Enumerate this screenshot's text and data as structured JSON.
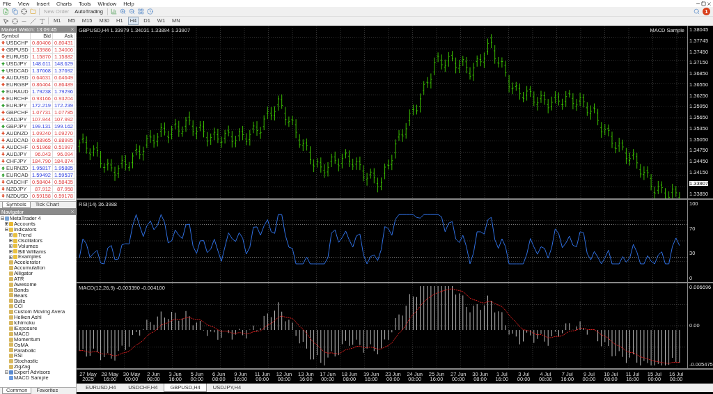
{
  "menu": [
    "File",
    "View",
    "Insert",
    "Charts",
    "Tools",
    "Window",
    "Help"
  ],
  "toolbar": {
    "buttons": [
      {
        "label": "New Order",
        "disabled": true
      },
      {
        "label": "AutoTrading",
        "disabled": false
      }
    ],
    "timeframes": [
      {
        "label": "M1",
        "selected": false
      },
      {
        "label": "M5",
        "selected": false
      },
      {
        "label": "M15",
        "selected": false
      },
      {
        "label": "M30",
        "selected": false
      },
      {
        "label": "H1",
        "selected": false
      },
      {
        "label": "H4",
        "selected": true
      },
      {
        "label": "D1",
        "selected": false
      },
      {
        "label": "W1",
        "selected": false
      },
      {
        "label": "MN",
        "selected": false
      }
    ],
    "notifications": "1"
  },
  "market_watch": {
    "title": "Market Watch: 13:09:45",
    "columns": [
      "Symbol",
      "Bid",
      "Ask"
    ],
    "rows": [
      {
        "symbol": "USDCHF",
        "bid": "0.80406",
        "ask": "0.80431",
        "rising": false
      },
      {
        "symbol": "GBPUSD",
        "bid": "1.33986",
        "ask": "1.34006",
        "rising": false
      },
      {
        "symbol": "EURUSD",
        "bid": "1.15870",
        "ask": "1.15882",
        "rising": false
      },
      {
        "symbol": "USDJPY",
        "bid": "148.611",
        "ask": "148.629",
        "rising": true
      },
      {
        "symbol": "USDCAD",
        "bid": "1.37668",
        "ask": "1.37692",
        "rising": true
      },
      {
        "symbol": "AUDUSD",
        "bid": "0.64631",
        "ask": "0.64649",
        "rising": false
      },
      {
        "symbol": "EURGBP",
        "bid": "0.86464",
        "ask": "0.86489",
        "rising": false
      },
      {
        "symbol": "EURAUD",
        "bid": "1.79238",
        "ask": "1.79296",
        "rising": true
      },
      {
        "symbol": "EURCHF",
        "bid": "0.93166",
        "ask": "0.93204",
        "rising": false
      },
      {
        "symbol": "EURJPY",
        "bid": "172.219",
        "ask": "172.239",
        "rising": true
      },
      {
        "symbol": "GBPCHF",
        "bid": "1.07731",
        "ask": "1.07785",
        "rising": false
      },
      {
        "symbol": "CADJPY",
        "bid": "107.944",
        "ask": "107.992",
        "rising": false
      },
      {
        "symbol": "GBPJPY",
        "bid": "199.131",
        "ask": "199.162",
        "rising": true
      },
      {
        "symbol": "AUDNZD",
        "bid": "1.09240",
        "ask": "1.09270",
        "rising": false
      },
      {
        "symbol": "AUDCAD",
        "bid": "0.88965",
        "ask": "0.88995",
        "rising": false
      },
      {
        "symbol": "AUDCHF",
        "bid": "0.51968",
        "ask": "0.51997",
        "rising": false
      },
      {
        "symbol": "AUDJPY",
        "bid": "96.043",
        "ask": "96.094",
        "rising": false
      },
      {
        "symbol": "CHFJPY",
        "bid": "184.790",
        "ask": "184.874",
        "rising": false
      },
      {
        "symbol": "EURNZD",
        "bid": "1.95817",
        "ask": "1.95885",
        "rising": true
      },
      {
        "symbol": "EURCAD",
        "bid": "1.59492",
        "ask": "1.59537",
        "rising": true
      },
      {
        "symbol": "CADCHF",
        "bid": "0.58404",
        "ask": "0.58435",
        "rising": false
      },
      {
        "symbol": "NZDJPY",
        "bid": "87.912",
        "ask": "87.958",
        "rising": false
      },
      {
        "symbol": "NZDUSD",
        "bid": "0.59158",
        "ask": "0.59178",
        "rising": false
      }
    ],
    "tabs": [
      {
        "label": "Symbols",
        "selected": true
      },
      {
        "label": "Tick Chart",
        "selected": false
      }
    ]
  },
  "navigator": {
    "title": "Navigator",
    "tree": [
      {
        "label": "MetaTrader 4",
        "kind": "root",
        "expanded": true,
        "children": [
          {
            "label": "Accounts",
            "kind": "accounts",
            "expanded": false
          },
          {
            "label": "Indicators",
            "kind": "folder",
            "expanded": true,
            "children": [
              {
                "label": "Trend",
                "kind": "folder",
                "expanded": false
              },
              {
                "label": "Oscillators",
                "kind": "folder",
                "expanded": false
              },
              {
                "label": "Volumes",
                "kind": "folder",
                "expanded": false
              },
              {
                "label": "Bill Williams",
                "kind": "folder",
                "expanded": false
              },
              {
                "label": "Examples",
                "kind": "folder",
                "expanded": false
              },
              {
                "label": "Accelerator",
                "kind": "indicator"
              },
              {
                "label": "Accumulation",
                "kind": "indicator"
              },
              {
                "label": "Alligator",
                "kind": "indicator"
              },
              {
                "label": "ATR",
                "kind": "indicator"
              },
              {
                "label": "Awesome",
                "kind": "indicator"
              },
              {
                "label": "Bands",
                "kind": "indicator"
              },
              {
                "label": "Bears",
                "kind": "indicator"
              },
              {
                "label": "Bulls",
                "kind": "indicator"
              },
              {
                "label": "CCI",
                "kind": "indicator"
              },
              {
                "label": "Custom Moving Avera",
                "kind": "indicator"
              },
              {
                "label": "Heiken Ashi",
                "kind": "indicator"
              },
              {
                "label": "Ichimoku",
                "kind": "indicator"
              },
              {
                "label": "iExposure",
                "kind": "indicator"
              },
              {
                "label": "MACD",
                "kind": "indicator"
              },
              {
                "label": "Momentum",
                "kind": "indicator"
              },
              {
                "label": "OsMA",
                "kind": "indicator"
              },
              {
                "label": "Parabolic",
                "kind": "indicator"
              },
              {
                "label": "RSI",
                "kind": "indicator"
              },
              {
                "label": "Stochastic",
                "kind": "indicator"
              },
              {
                "label": "ZigZag",
                "kind": "indicator"
              }
            ]
          },
          {
            "label": "Expert Advisors",
            "kind": "experts",
            "expanded": true,
            "children": [
              {
                "label": "MACD Sample",
                "kind": "expert"
              }
            ]
          }
        ]
      }
    ],
    "tabs": [
      {
        "label": "Common",
        "selected": true
      },
      {
        "label": "Favorites",
        "selected": false
      }
    ]
  },
  "chart": {
    "title": "GBPUSD,H4  1.33979 1.34031 1.33894 1.33907",
    "expert": "MACD Sample",
    "price_axis": [
      "1.38045",
      "1.37745",
      "1.37450",
      "1.37150",
      "1.36850",
      "1.36550",
      "1.36250",
      "1.35950",
      "1.35650",
      "1.35350",
      "1.35050",
      "1.34750",
      "1.34450",
      "1.34150",
      "1.33850"
    ],
    "current_price": "1.33907",
    "rsi": {
      "label": "RSI(14) 36.3988",
      "axis": [
        "100",
        "70",
        "30",
        "0"
      ]
    },
    "macd": {
      "label": "MACD(12,26,9) -0.003390 -0.004100",
      "axis": [
        "0.006696",
        "0.00",
        "-0.005475"
      ]
    },
    "time_axis": [
      "27 May 2025",
      "28 May 16:00",
      "30 May 00:00",
      "2 Jun 08:00",
      "3 Jun 16:00",
      "5 Jun 00:00",
      "6 Jun 08:00",
      "9 Jun 16:00",
      "11 Jun 00:00",
      "12 Jun 08:00",
      "13 Jun 16:00",
      "17 Jun 00:00",
      "18 Jun 08:00",
      "19 Jun 16:00",
      "23 Jun 00:00",
      "24 Jun 08:00",
      "25 Jun 16:00",
      "27 Jun 00:00",
      "30 Jun 08:00",
      "1 Jul 16:00",
      "3 Jul 00:00",
      "4 Jul 08:00",
      "7 Jul 16:00",
      "9 Jul 00:00",
      "10 Jul 08:00",
      "11 Jul 16:00",
      "15 Jul 00:00",
      "16 Jul 08:00"
    ],
    "tabs": [
      {
        "label": "EURUSD,H4",
        "selected": false
      },
      {
        "label": "USDCHF,H4",
        "selected": false
      },
      {
        "label": "GBPUSD,H4",
        "selected": true
      },
      {
        "label": "USDJPY,H4",
        "selected": false
      }
    ]
  }
}
